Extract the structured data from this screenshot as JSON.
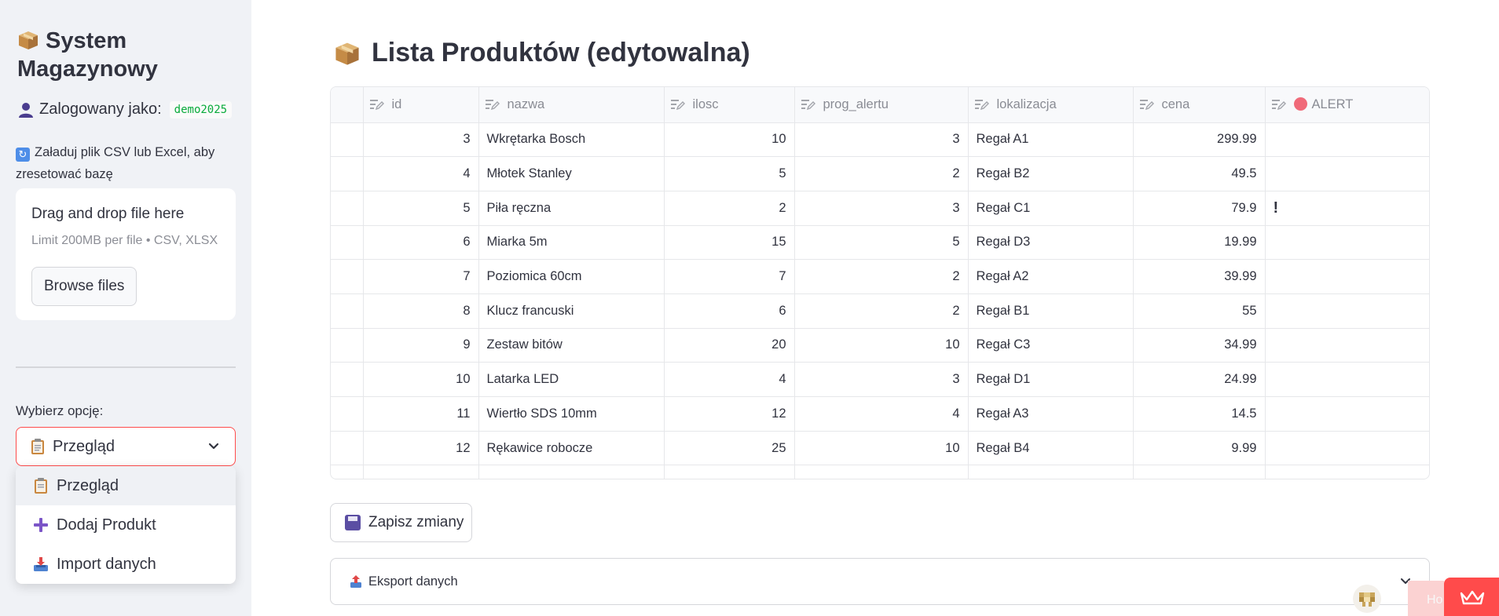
{
  "sidebar": {
    "title": "System Magazynowy",
    "logged_in_label": "Zalogowany jako:",
    "username": "demo2025",
    "upload_label": "Załaduj plik CSV lub Excel, aby zresetować bazę",
    "dropzone": {
      "title": "Drag and drop file here",
      "limit": "Limit 200MB per file • CSV, XLSX",
      "browse_label": "Browse files"
    },
    "select_label": "Wybierz opcję:",
    "selected": "Przegląd",
    "options": [
      "Przegląd",
      "Dodaj Produkt",
      "Import danych"
    ]
  },
  "main": {
    "title": "Lista Produktów (edytowalna)",
    "columns": [
      "id",
      "nazwa",
      "ilosc",
      "prog_alertu",
      "lokalizacja",
      "cena",
      "ALERT"
    ],
    "rows": [
      {
        "id": "3",
        "nazwa": "Wkrętarka Bosch",
        "ilosc": "10",
        "prog_alertu": "3",
        "lokalizacja": "Regał A1",
        "cena": "299.99",
        "alert": ""
      },
      {
        "id": "4",
        "nazwa": "Młotek Stanley",
        "ilosc": "5",
        "prog_alertu": "2",
        "lokalizacja": "Regał B2",
        "cena": "49.5",
        "alert": ""
      },
      {
        "id": "5",
        "nazwa": "Piła ręczna",
        "ilosc": "2",
        "prog_alertu": "3",
        "lokalizacja": "Regał C1",
        "cena": "79.9",
        "alert": "!"
      },
      {
        "id": "6",
        "nazwa": "Miarka 5m",
        "ilosc": "15",
        "prog_alertu": "5",
        "lokalizacja": "Regał D3",
        "cena": "19.99",
        "alert": ""
      },
      {
        "id": "7",
        "nazwa": "Poziomica 60cm",
        "ilosc": "7",
        "prog_alertu": "2",
        "lokalizacja": "Regał A2",
        "cena": "39.99",
        "alert": ""
      },
      {
        "id": "8",
        "nazwa": "Klucz francuski",
        "ilosc": "6",
        "prog_alertu": "2",
        "lokalizacja": "Regał B1",
        "cena": "55",
        "alert": ""
      },
      {
        "id": "9",
        "nazwa": "Zestaw bitów",
        "ilosc": "20",
        "prog_alertu": "10",
        "lokalizacja": "Regał C3",
        "cena": "34.99",
        "alert": ""
      },
      {
        "id": "10",
        "nazwa": "Latarka LED",
        "ilosc": "4",
        "prog_alertu": "3",
        "lokalizacja": "Regał D1",
        "cena": "24.99",
        "alert": ""
      },
      {
        "id": "11",
        "nazwa": "Wiertło SDS 10mm",
        "ilosc": "12",
        "prog_alertu": "4",
        "lokalizacja": "Regał A3",
        "cena": "14.5",
        "alert": ""
      },
      {
        "id": "12",
        "nazwa": "Rękawice robocze",
        "ilosc": "25",
        "prog_alertu": "10",
        "lokalizacja": "Regał B4",
        "cena": "9.99",
        "alert": ""
      }
    ],
    "save_label": "Zapisz zmiany",
    "export_label": "Eksport danych",
    "corner_ghost_text": "Ho"
  },
  "icons": {
    "title": "package-icon",
    "user": "user-icon",
    "refresh": "refresh-icon",
    "options": [
      "clipboard-icon",
      "plus-icon",
      "inbox-tray-icon"
    ],
    "save": "floppy-disk-icon",
    "export": "outbox-tray-icon"
  },
  "colors": {
    "accent": "#ff4b4b",
    "sidebar_bg": "#f0f2f6",
    "code_green": "#09ab3b",
    "alert_red": "#e8323c",
    "alert_dot": "#f06a79"
  }
}
